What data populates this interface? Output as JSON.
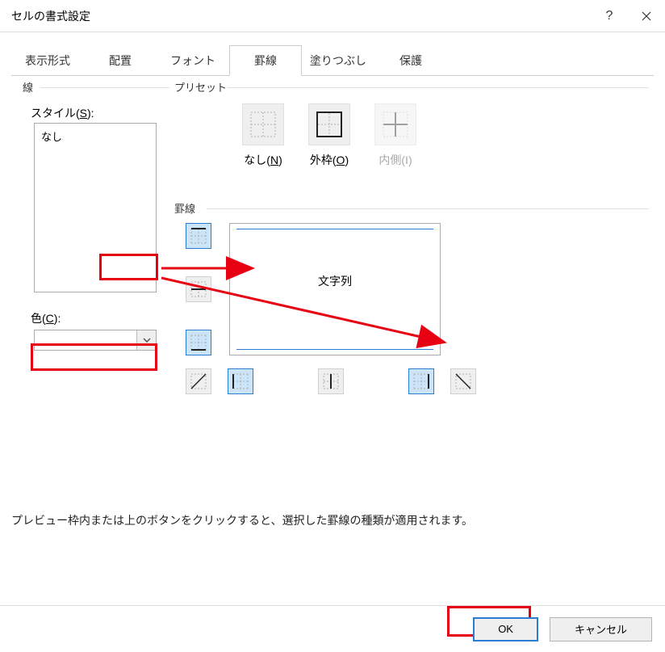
{
  "window": {
    "title": "セルの書式設定",
    "help_label": "?",
    "close_label": "×"
  },
  "tabs": {
    "items": [
      {
        "label": "表示形式",
        "active": false
      },
      {
        "label": "配置",
        "active": false
      },
      {
        "label": "フォント",
        "active": false
      },
      {
        "label": "罫線",
        "active": true
      },
      {
        "label": "塗りつぶし",
        "active": false
      },
      {
        "label": "保護",
        "active": false
      }
    ]
  },
  "line": {
    "group_label": "線",
    "style_label_prefix": "スタイル(",
    "style_hotkey": "S",
    "style_label_suffix": "):",
    "none_label": "なし",
    "color_label_prefix": "色(",
    "color_hotkey": "C",
    "color_label_suffix": "):"
  },
  "preset": {
    "group_label": "プリセット",
    "none_prefix": "なし(",
    "none_hot": "N",
    "none_suffix": ")",
    "outer_prefix": "外枠(",
    "outer_hot": "O",
    "outer_suffix": ")",
    "inner_prefix": "内側(",
    "inner_hot": "I",
    "inner_suffix": ")"
  },
  "border": {
    "group_label": "罫線",
    "preview_text": "文字列"
  },
  "hint": "プレビュー枠内または上のボタンをクリックすると、選択した罫線の種類が適用されます。",
  "buttons": {
    "ok": "OK",
    "cancel": "キャンセル"
  }
}
